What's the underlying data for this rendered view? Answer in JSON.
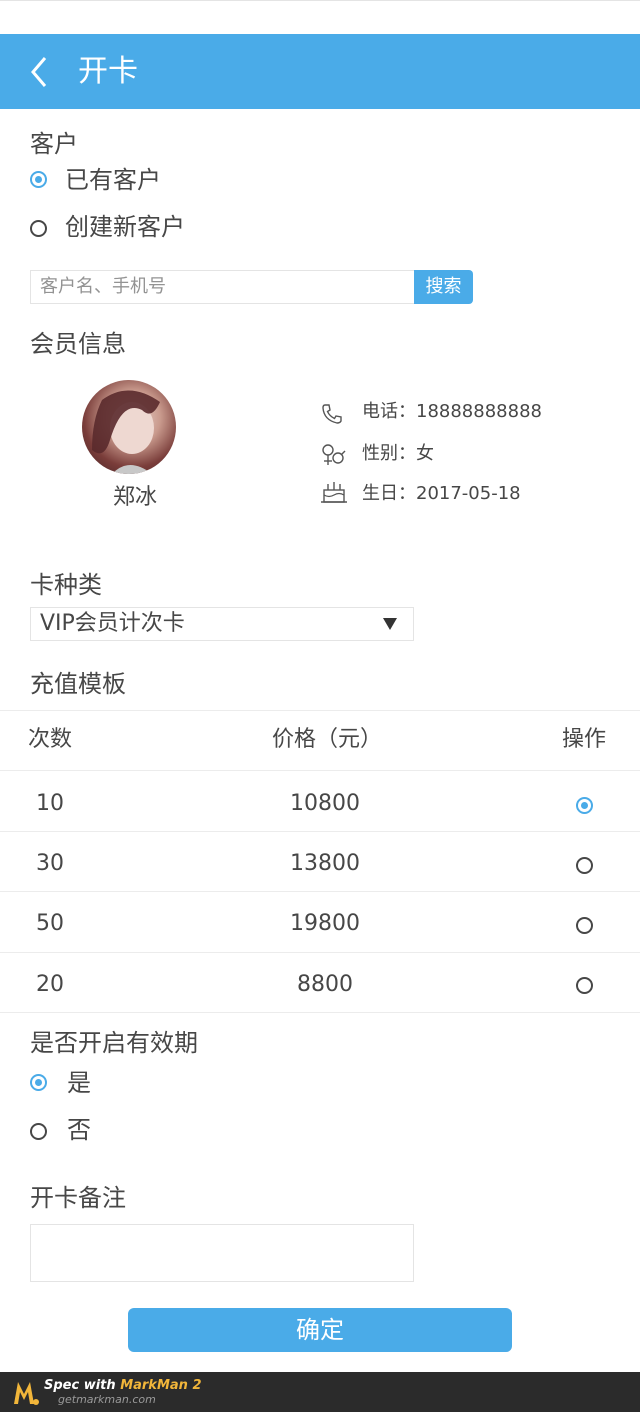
{
  "header": {
    "title": "开卡",
    "back_icon": "chevron-left-icon",
    "background": "#4aabe8"
  },
  "customer": {
    "section_label": "客户",
    "options": [
      {
        "label": "已有客户",
        "selected": true
      },
      {
        "label": "创建新客户",
        "selected": false
      }
    ],
    "search_placeholder": "客户名、手机号",
    "search_button": "搜索"
  },
  "member": {
    "section_label": "会员信息",
    "name": "郑冰",
    "phone": "电话：18888888888",
    "gender": "性别：女",
    "birthday": "生日：2017-05-18"
  },
  "card_type": {
    "label": "卡种类",
    "selected": "VIP会员计次卡"
  },
  "template": {
    "label": "充值模板",
    "headers": [
      "次数",
      "价格（元）",
      "操作"
    ],
    "rows": [
      {
        "count": "10",
        "price": "10800",
        "selected": true
      },
      {
        "count": "30",
        "price": "13800",
        "selected": false
      },
      {
        "count": "50",
        "price": "19800",
        "selected": false
      },
      {
        "count": "20",
        "price": "8800",
        "selected": false
      }
    ]
  },
  "validity": {
    "label": "是否开启有效期",
    "options": [
      {
        "label": "是",
        "selected": true
      },
      {
        "label": "否",
        "selected": false
      }
    ]
  },
  "remark": {
    "label": "开卡备注"
  },
  "confirm_label": "确定",
  "footer": {
    "line1_a": "Spec with ",
    "line1_b": "MarkMan 2",
    "line2": "getmarkman.com"
  },
  "colors": {
    "accent": "#4aabe8",
    "text": "#474747",
    "placeholder": "#939393",
    "footer": "#2b2b2b"
  }
}
